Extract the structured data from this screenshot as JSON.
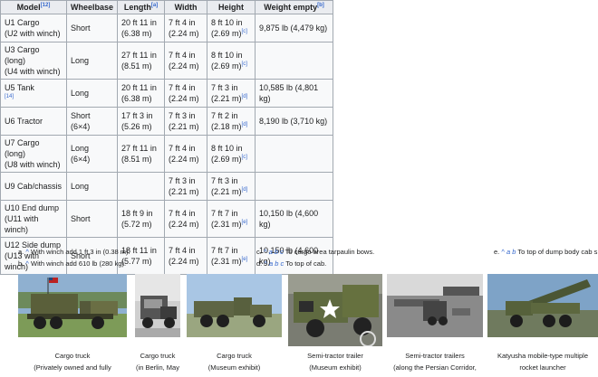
{
  "table": {
    "headers": [
      {
        "label": "Model",
        "ref": "[12]"
      },
      {
        "label": "Wheelbase",
        "ref": ""
      },
      {
        "label": "Length",
        "ref": "[a]"
      },
      {
        "label": "Width",
        "ref": ""
      },
      {
        "label": "Height",
        "ref": ""
      },
      {
        "label": "Weight empty",
        "ref": "[b]"
      }
    ],
    "rows": [
      {
        "model1": "U1 Cargo",
        "model2": "(U2 with winch)",
        "model_ref": "",
        "wheel1": "Short",
        "wheel2": "",
        "len1": "20 ft 11 in",
        "len2": "(6.38 m)",
        "wid1": "7 ft 4 in",
        "wid2": "(2.24 m)",
        "hei1": "8 ft 10 in",
        "hei2": "(2.69 m)",
        "hei_ref": "[c]",
        "wt1": "9,875 lb (4,479 kg)"
      },
      {
        "model1": "U3 Cargo (long)",
        "model2": "(U4 with winch)",
        "model_ref": "",
        "wheel1": "Long",
        "wheel2": "",
        "len1": "27 ft 11 in",
        "len2": "(8.51 m)",
        "wid1": "7 ft 4 in",
        "wid2": "(2.24 m)",
        "hei1": "8 ft 10 in",
        "hei2": "(2.69 m)",
        "hei_ref": "[c]",
        "wt1": ""
      },
      {
        "model1": "U5 Tank",
        "model2": "",
        "model_ref": "[14]",
        "wheel1": "Long",
        "wheel2": "",
        "len1": "20 ft 11 in",
        "len2": "(6.38 m)",
        "wid1": "7 ft 4 in",
        "wid2": "(2.24 m)",
        "hei1": "7 ft 3 in",
        "hei2": "(2.21 m)",
        "hei_ref": "[d]",
        "wt1": "10,585 lb (4,801 kg)"
      },
      {
        "model1": "U6 Tractor",
        "model2": "",
        "model_ref": "",
        "wheel1": "Short",
        "wheel2": "(6×4)",
        "len1": "17 ft 3 in",
        "len2": "(5.26 m)",
        "wid1": "7 ft 3 in",
        "wid2": "(2.21 m)",
        "hei1": "7 ft 2 in",
        "hei2": "(2.18 m)",
        "hei_ref": "[d]",
        "wt1": "8,190 lb (3,710 kg)"
      },
      {
        "model1": "U7 Cargo (long)",
        "model2": "(U8 with winch)",
        "model_ref": "",
        "wheel1": "Long",
        "wheel2": "(6×4)",
        "len1": "27 ft 11 in",
        "len2": "(8.51 m)",
        "wid1": "7 ft 4 in",
        "wid2": "(2.24 m)",
        "hei1": "8 ft 10 in",
        "hei2": "(2.69 m)",
        "hei_ref": "[c]",
        "wt1": ""
      },
      {
        "model1": "U9 Cab/chassis",
        "model2": "",
        "model_ref": "",
        "wheel1": "Long",
        "wheel2": "",
        "len1": "",
        "len2": "",
        "wid1": "7 ft 3 in",
        "wid2": "(2.21 m)",
        "hei1": "7 ft 3 in",
        "hei2": "(2.21 m)",
        "hei_ref": "[d]",
        "wt1": ""
      },
      {
        "model1": "U10 End dump",
        "model2": "(U11 with winch)",
        "model_ref": "",
        "wheel1": "Short",
        "wheel2": "",
        "len1": "18 ft 9 in",
        "len2": "(5.72 m)",
        "wid1": "7 ft 4 in",
        "wid2": "(2.24 m)",
        "hei1": "7 ft 7 in",
        "hei2": "(2.31 m)",
        "hei_ref": "[e]",
        "wt1": "10,150 lb (4,600 kg)"
      },
      {
        "model1": "U12 Side dump",
        "model2": "(U13 with winch)",
        "model_ref": "",
        "wheel1": "Short",
        "wheel2": "",
        "len1": "18 ft 11 in",
        "len2": "(5.77 m)",
        "wid1": "7 ft 4 in",
        "wid2": "(2.24 m)",
        "hei1": "7 ft 7 in",
        "hei2": "(2.31 m)",
        "hei_ref": "[e]",
        "wt1": "10,150 lb (4,600 kg)"
      }
    ]
  },
  "notes": {
    "a": {
      "marker": "a.",
      "caret": "^",
      "text": "With winch add 1 ft 3 in (0.38 m)."
    },
    "b": {
      "marker": "b.",
      "caret": "^",
      "text": "With winch add 610 lb (280 kg)."
    },
    "c": {
      "marker": "c.",
      "caret": "^",
      "letters": "a b c",
      "text": "To cargo area tarpaulin bows."
    },
    "d": {
      "marker": "d.",
      "caret": "^",
      "letters": "a b c",
      "text": "To top of cab."
    },
    "e": {
      "marker": "e.",
      "caret": "^",
      "letters": "a b",
      "text": "To top of dump body cab s"
    }
  },
  "gallery": [
    {
      "icon": "cargo-truck-photo",
      "caption1": "Cargo truck",
      "caption2": "(Privately owned and fully"
    },
    {
      "icon": "cargo-truck-berlin-photo",
      "caption1": "Cargo truck",
      "caption2": "(in Berlin, May"
    },
    {
      "icon": "cargo-truck-museum-photo",
      "caption1": "Cargo truck",
      "caption2": "(Museum exhibit)"
    },
    {
      "icon": "semi-tractor-trailer-photo",
      "caption1": "Semi-tractor trailer",
      "caption2": "(Museum exhibit)"
    },
    {
      "icon": "semi-tractor-trailers-photo",
      "caption1": "Semi-tractor trailers",
      "caption2": "(along the Persian Corridor,"
    },
    {
      "icon": "katyusha-rocket-launcher-photo",
      "caption1": "Katyusha mobile-type multiple",
      "caption2": "rocket launcher"
    }
  ],
  "colors": {
    "link": "#3366cc",
    "header_bg": "#eaecf0",
    "cell_bg": "#f8f9fa",
    "border": "#a2a9b1"
  }
}
